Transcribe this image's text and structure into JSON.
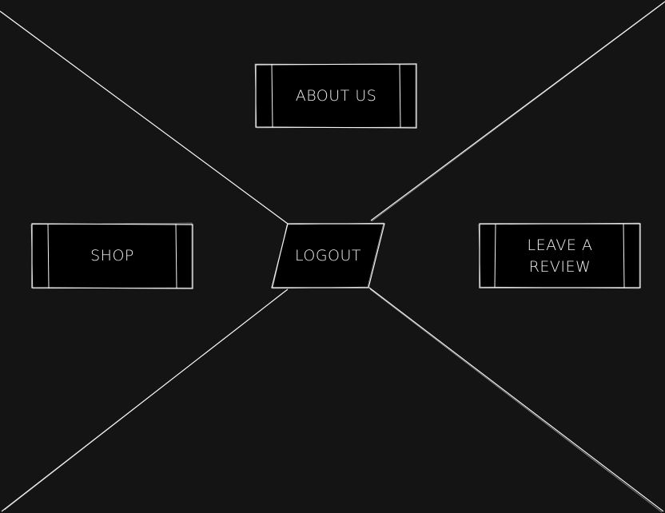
{
  "diagram": {
    "center": {
      "label": "LOGOUT"
    },
    "top": {
      "label": "ABOUT US"
    },
    "left": {
      "label": "SHOP"
    },
    "right": {
      "label": "LEAVE A REVIEW"
    }
  },
  "colors": {
    "background": "#141414",
    "stroke": "#f5f5f5",
    "box_fill": "#000000",
    "text": "#f2f2f2"
  }
}
